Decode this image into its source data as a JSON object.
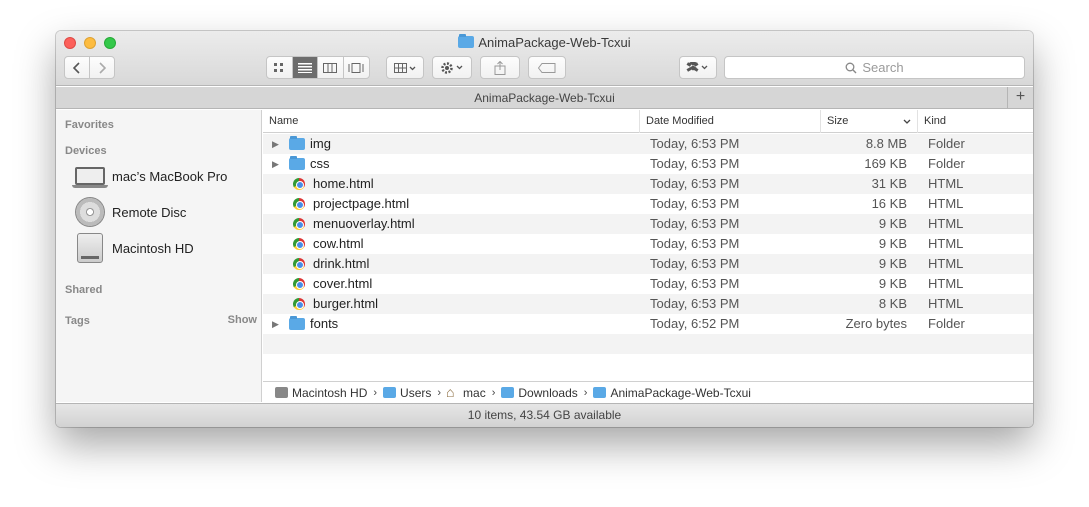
{
  "window": {
    "title": "AnimaPackage-Web-Tcxui",
    "path_title": "AnimaPackage-Web-Tcxui",
    "status": "10 items, 43.54 GB available"
  },
  "toolbar": {
    "search_placeholder": "Search"
  },
  "sidebar": {
    "favorites": "Favorites",
    "devices": "Devices",
    "device_items": [
      {
        "label": "mac’s MacBook Pro",
        "icon": "laptop-icon"
      },
      {
        "label": "Remote Disc",
        "icon": "disc-icon"
      },
      {
        "label": "Macintosh HD",
        "icon": "hard-drive-icon"
      }
    ],
    "shared": "Shared",
    "tags": "Tags",
    "show": "Show"
  },
  "columns": {
    "name": "Name",
    "date": "Date Modified",
    "size": "Size",
    "kind": "Kind"
  },
  "files": [
    {
      "name": "img",
      "date": "Today, 6:53 PM",
      "size": "8.8 MB",
      "kind": "Folder",
      "type": "folder"
    },
    {
      "name": "css",
      "date": "Today, 6:53 PM",
      "size": "169 KB",
      "kind": "Folder",
      "type": "folder"
    },
    {
      "name": "home.html",
      "date": "Today, 6:53 PM",
      "size": "31 KB",
      "kind": "HTML",
      "type": "html"
    },
    {
      "name": "projectpage.html",
      "date": "Today, 6:53 PM",
      "size": "16 KB",
      "kind": "HTML",
      "type": "html"
    },
    {
      "name": "menuoverlay.html",
      "date": "Today, 6:53 PM",
      "size": "9 KB",
      "kind": "HTML",
      "type": "html"
    },
    {
      "name": "cow.html",
      "date": "Today, 6:53 PM",
      "size": "9 KB",
      "kind": "HTML",
      "type": "html"
    },
    {
      "name": "drink.html",
      "date": "Today, 6:53 PM",
      "size": "9 KB",
      "kind": "HTML",
      "type": "html"
    },
    {
      "name": "cover.html",
      "date": "Today, 6:53 PM",
      "size": "9 KB",
      "kind": "HTML",
      "type": "html"
    },
    {
      "name": "burger.html",
      "date": "Today, 6:53 PM",
      "size": "8 KB",
      "kind": "HTML",
      "type": "html"
    },
    {
      "name": "fonts",
      "date": "Today, 6:52 PM",
      "size": "Zero bytes",
      "kind": "Folder",
      "type": "folder"
    }
  ],
  "breadcrumb": [
    {
      "label": "Macintosh HD",
      "icon": "hard-drive-icon"
    },
    {
      "label": "Users",
      "icon": "folder-icon"
    },
    {
      "label": "mac",
      "icon": "home-icon"
    },
    {
      "label": "Downloads",
      "icon": "downloads-folder-icon"
    },
    {
      "label": "AnimaPackage-Web-Tcxui",
      "icon": "folder-icon"
    }
  ],
  "colors": {
    "folder": "#5aa9e6",
    "close": "#fc605b",
    "minimize": "#fdbc40",
    "maximize": "#34c84a"
  }
}
